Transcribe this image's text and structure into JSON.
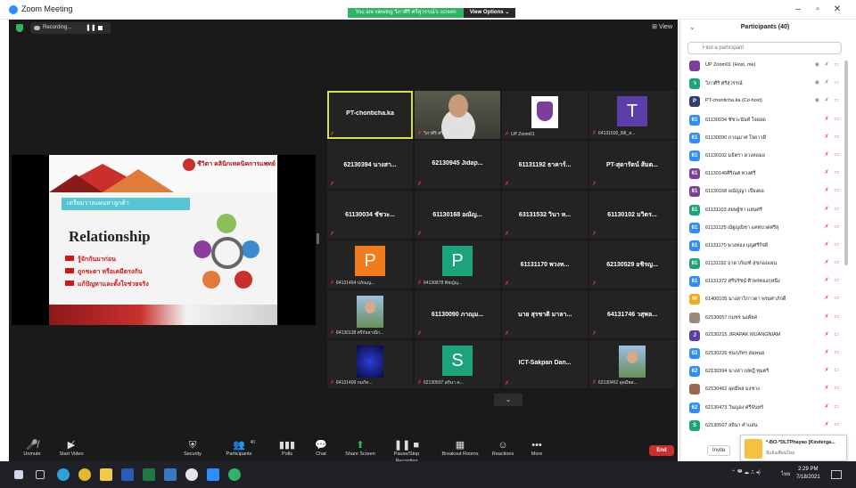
{
  "window": {
    "title": "Zoom Meeting",
    "viewing_banner": "You are viewing วิภาศิริ ศรีสุวรรณ์'s screen",
    "view_options": "View Options ⌄",
    "minimize": "–",
    "maximize": "▫",
    "close": "✕"
  },
  "meeting_bar": {
    "recording_label": "Recording...",
    "pause_glyph": "❚❚",
    "view_label": "⊞ View"
  },
  "slide": {
    "org_name": "ชีวิตา คลินิกเทคนิคการแพทย์",
    "tag": "เตรียมวางแผนหาลูกค้า",
    "title": "Relationship",
    "bullets": [
      "รู้จักกันมาก่อน",
      "ถูกชะตา หรือเคมีตรงกัน",
      "แก้ปัญหาและตั้งใจช่วยจริง"
    ]
  },
  "gallery": {
    "tiles": [
      {
        "label": "PT-chonticha.ka",
        "bottom": "",
        "kind": "text",
        "active": true
      },
      {
        "label": "",
        "bottom": "วิภาศิริ ศรีสุวรรณ์",
        "kind": "video",
        "active": false
      },
      {
        "label": "",
        "bottom": "UP Zoom01",
        "kind": "logo",
        "active": false
      },
      {
        "label": "",
        "bottom": "64131500_ธิติ_ส...",
        "kind": "avatar",
        "letter": "T",
        "color": "#5b3ea8",
        "active": false
      },
      {
        "label": "62130394 นางสา...",
        "bottom": "",
        "kind": "text"
      },
      {
        "label": "62130945 Jidap...",
        "bottom": "",
        "kind": "text"
      },
      {
        "label": "61131192 ธาคาร์...",
        "bottom": "",
        "kind": "text"
      },
      {
        "label": "PT-สุดารัตน์ ส้มต...",
        "bottom": "",
        "kind": "text"
      },
      {
        "label": "61130034 ชัชวะ...",
        "bottom": "",
        "kind": "text"
      },
      {
        "label": "61130168 อณัญ...",
        "bottom": "",
        "kind": "text"
      },
      {
        "label": "63131532 วินา ห...",
        "bottom": "",
        "kind": "text"
      },
      {
        "label": "61130102 มวิตร...",
        "bottom": "",
        "kind": "text"
      },
      {
        "label": "",
        "bottom": "64131464 ปภัณญ...",
        "kind": "avatar",
        "letter": "P",
        "color": "#f07c1c"
      },
      {
        "label": "",
        "bottom": "64130878 พิชญ์ญ...",
        "kind": "avatar",
        "letter": "P",
        "color": "#1ba37a"
      },
      {
        "label": "61131170 พวงท...",
        "bottom": "",
        "kind": "text"
      },
      {
        "label": "62130529 อชิรญ...",
        "bottom": "",
        "kind": "text"
      },
      {
        "label": "",
        "bottom": "64130138 ศรีกัลยาณีก...",
        "kind": "photo"
      },
      {
        "label": "61130090 ภาณุม...",
        "bottom": "",
        "kind": "text"
      },
      {
        "label": "นาย สุรชาติ มาลา...",
        "bottom": "",
        "kind": "text"
      },
      {
        "label": "64131746 วสุพล...",
        "bottom": "",
        "kind": "text"
      },
      {
        "label": "",
        "bottom": "64131409 กมกัท...",
        "kind": "blue"
      },
      {
        "label": "",
        "bottom": "62130507 สถินา ค...",
        "kind": "avatar",
        "letter": "S",
        "color": "#1ba37a"
      },
      {
        "label": "ICT-Sakpan Dan...",
        "bottom": "",
        "kind": "text"
      },
      {
        "label": "",
        "bottom": "62130462 อุดมีพล...",
        "kind": "photo"
      }
    ],
    "more_chevron": "⌄"
  },
  "toolbar": {
    "items": [
      {
        "icon": "🎤̸",
        "label": "Unmute"
      },
      {
        "icon": "▶̸",
        "label": "Start Video"
      },
      {
        "icon": "⛨",
        "label": "Security"
      },
      {
        "icon": "👥",
        "label": "Participants",
        "badge": "40"
      },
      {
        "icon": "▮▮▮",
        "label": "Polls"
      },
      {
        "icon": "💬",
        "label": "Chat"
      },
      {
        "icon": "⬆",
        "label": "Share Screen"
      },
      {
        "icon": "❚❚ ■",
        "label": "Pause/Stop Recording"
      },
      {
        "icon": "▦",
        "label": "Breakout Rooms"
      },
      {
        "icon": "☺",
        "label": "Reactions"
      },
      {
        "icon": "•••",
        "label": "More"
      }
    ],
    "end_label": "End"
  },
  "participants_panel": {
    "title": "Participants (40)",
    "collapse": "⌄",
    "search_placeholder": "Find a participant",
    "invite_label": "Invite",
    "participants": [
      {
        "name": "UP Zoom01 (Host, me)",
        "initial": "",
        "color": "#7b3f9a"
      },
      {
        "name": "วิภาศิริ ศรีสุวรรณ์",
        "initial": "ว",
        "color": "#1ba37a"
      },
      {
        "name": "PT-chonticha.ka (Co-host)",
        "initial": "P",
        "color": "#2f3e6b"
      },
      {
        "name": "61130034 ชัชวะนันท์ ใจยอด",
        "initial": "61",
        "color": "#2d8cff"
      },
      {
        "name": "61130090 ภาณุมาศ ใจยาวดี",
        "initial": "61",
        "color": "#2d8cff"
      },
      {
        "name": "61130102 มธิตรา ดวงหอมอ",
        "initial": "61",
        "color": "#2d8cff"
      },
      {
        "name": "61130146ศิริณศ ทวงศรี",
        "initial": "61",
        "color": "#7b3f9a"
      },
      {
        "name": "61130168 อณัญญา เปียงผอ",
        "initial": "61",
        "color": "#7b3f9a"
      },
      {
        "name": "61131103 สยษฐ์ชา แสนศรี",
        "initial": "61",
        "color": "#1ba37a"
      },
      {
        "name": "61131125 ณัฐญณิชา แคทบวดศรีสุ",
        "initial": "61",
        "color": "#2d8cff"
      },
      {
        "name": "61131170 พวงทอง บุญศรีกิจยี่",
        "initial": "61",
        "color": "#2d8cff"
      },
      {
        "name": "61131192 ธาดาภัณฑ์ สุขกองแผน",
        "initial": "61",
        "color": "#1ba37a"
      },
      {
        "name": "61131372 ศรีปรัชน์ ศิวพรทองกุหนึ่ง",
        "initial": "61",
        "color": "#2d8cff"
      },
      {
        "name": "61400105 นางสาวิภาวดา พรมศาภักดิ์",
        "initial": "W",
        "color": "#f0a81c"
      },
      {
        "name": "62130057 กมชร นงค์ยศ",
        "initial": "",
        "color": "#9a8a7a"
      },
      {
        "name": "62130215 JIRAPAK MUANGNIAM",
        "initial": "J",
        "color": "#5b3ea8"
      },
      {
        "name": "62130226 ชนกภัทร สมพนย",
        "initial": "62",
        "color": "#2d8cff"
      },
      {
        "name": "62130394 นางสาวปทฎิ ทุมตรี",
        "initial": "62",
        "color": "#2d8cff"
      },
      {
        "name": "62130462 อุดมีพล มงชาง",
        "initial": "",
        "color": "#9a6a4a"
      },
      {
        "name": "62130473 วันญอง ศรีจันทร์",
        "initial": "62",
        "color": "#2d8cff"
      },
      {
        "name": "62130507 สถินา คำแสน",
        "initial": "S",
        "color": "#1ba37a"
      }
    ]
  },
  "notification": {
    "title": "*-BO-*DLTPhayao [Kinderga...",
    "subtitle": "มีแจ้งเตือนใหม่"
  },
  "taskbar": {
    "lang": "ไทย",
    "time": "2:29 PM",
    "date": "7/18/2021"
  }
}
